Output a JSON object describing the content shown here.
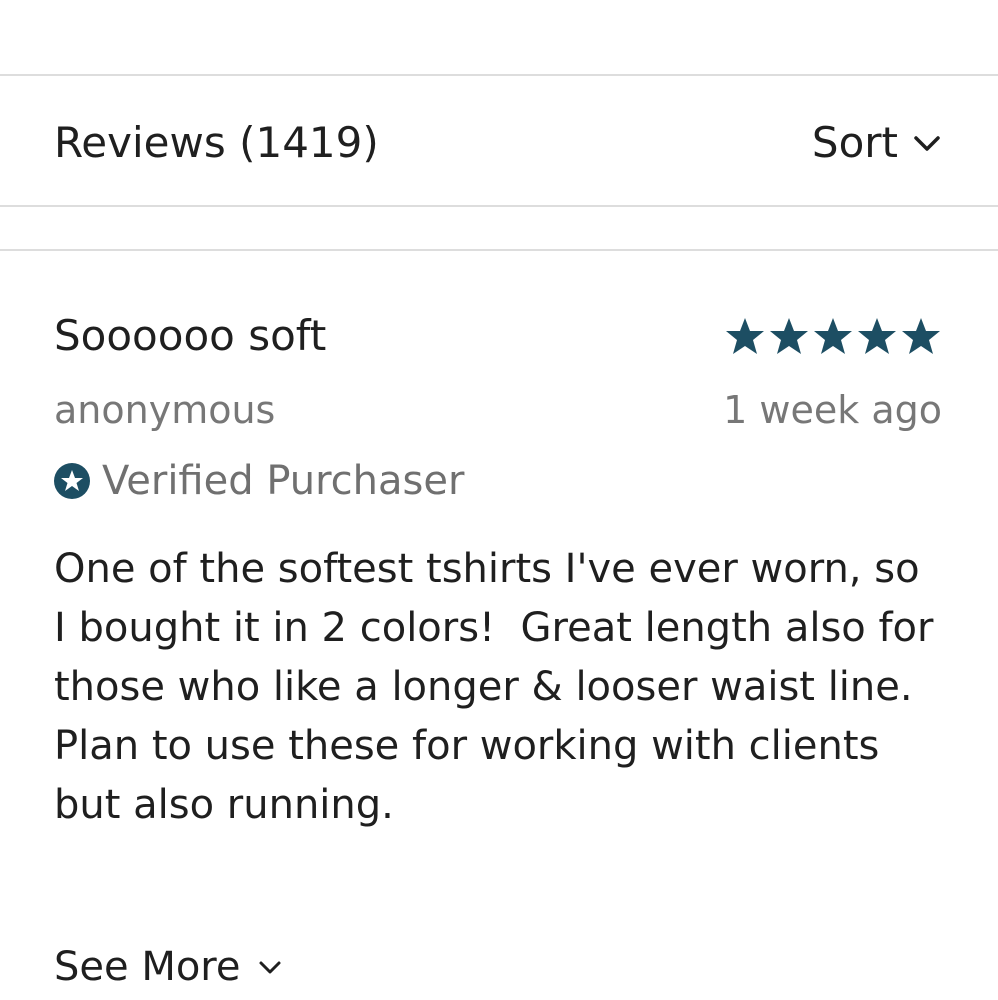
{
  "header": {
    "reviews_label": "Reviews (1419)",
    "sort_label": "Sort",
    "sort_icon": "chevron-down-icon"
  },
  "review": {
    "title": "Soooooo soft",
    "rating": 5,
    "rating_max": 5,
    "author": "anonymous",
    "date": "1 week ago",
    "verified_label": "Verified Purchaser",
    "verified_icon": "star-badge-icon",
    "body": "One of the softest tshirts I've ever worn, so I bought it in 2 colors!  Great length also for those who like a longer & looser waist line. Plan to use these for working with clients but also running.",
    "see_more_label": "See More"
  },
  "colors": {
    "accent": "#1d4e63",
    "text": "#1f1f1f",
    "muted": "#777777",
    "divider": "#dddddd"
  }
}
